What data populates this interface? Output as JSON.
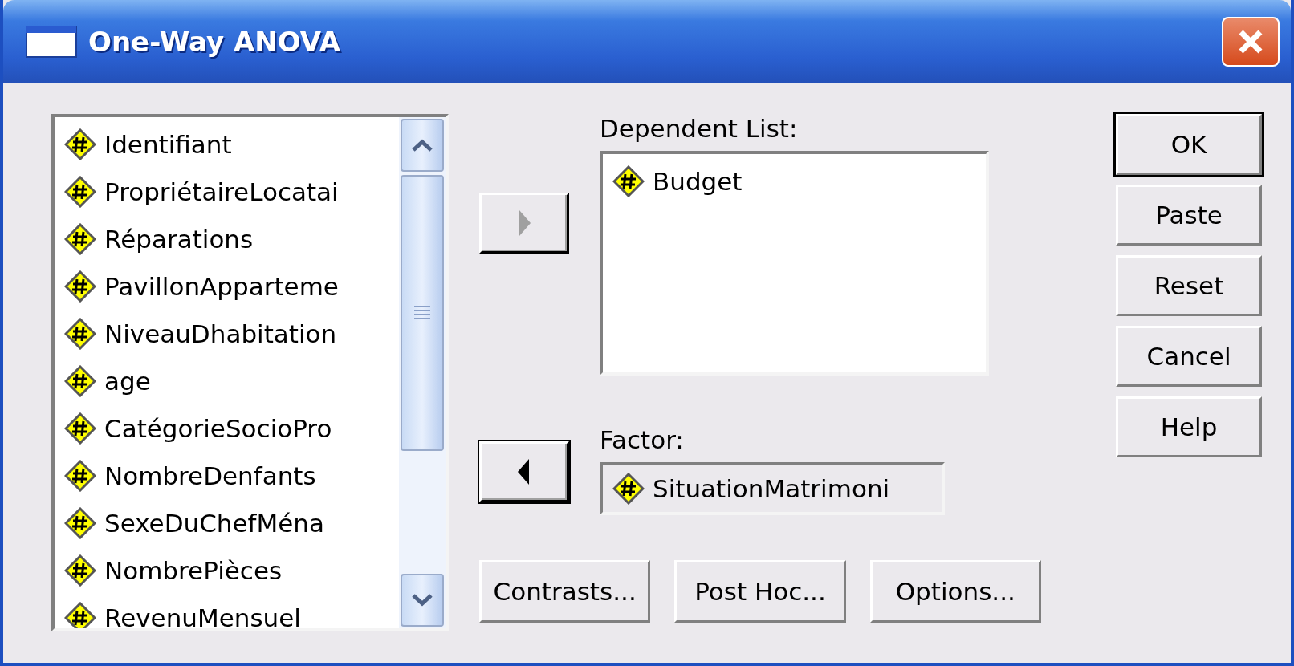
{
  "window": {
    "title": "One-Way ANOVA"
  },
  "variables": [
    "Identifiant",
    "PropriétaireLocatai",
    "Réparations",
    "PavillonApparteme",
    "NiveauDhabitation",
    "age",
    "CatégorieSocioPro",
    "NombreDenfants",
    "SexeDuChefMéna",
    "NombrePièces",
    "RevenuMensuel"
  ],
  "move_buttons": [
    {
      "kind": "right",
      "disabled": true
    },
    {
      "kind": "left",
      "disabled": false
    }
  ],
  "dependent_list": {
    "label": "Dependent List:",
    "items": [
      "Budget"
    ]
  },
  "factor": {
    "label": "Factor:",
    "value": "SituationMatrimoni"
  },
  "side_buttons": [
    {
      "label": "OK",
      "default": true
    },
    {
      "label": "Paste",
      "default": false
    },
    {
      "label": "Reset",
      "default": false
    },
    {
      "label": "Cancel",
      "default": false
    },
    {
      "label": "Help",
      "default": false
    }
  ],
  "bottom_buttons": [
    "Contrasts...",
    "Post Hoc...",
    "Options..."
  ]
}
